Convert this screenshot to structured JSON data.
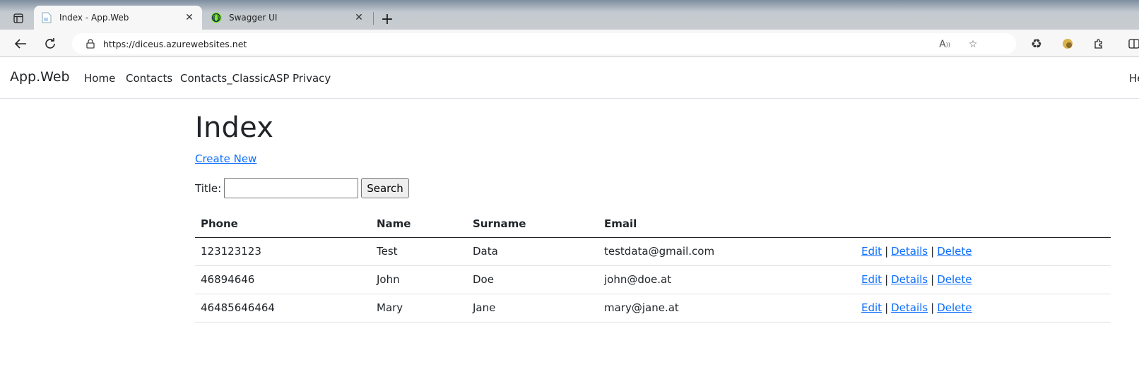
{
  "browser": {
    "tabs": [
      {
        "title": "Index - App.Web",
        "active": true,
        "icon": "page-icon"
      },
      {
        "title": "Swagger UI",
        "active": false,
        "icon": "swagger-icon"
      }
    ],
    "url": "https://diceus.azurewebsites.net",
    "toolbar_icons": [
      "back-icon",
      "refresh-icon",
      "lock-icon",
      "read-aloud-icon",
      "favorite-icon",
      "recycle-icon",
      "extension-icon",
      "puzzle-icon",
      "split-screen-icon"
    ]
  },
  "navbar": {
    "brand": "App.Web",
    "links": [
      "Home",
      "Contacts",
      "Contacts_ClassicASP",
      "Privacy"
    ],
    "right_text": "He"
  },
  "main": {
    "title": "Index",
    "create_link": "Create New",
    "search": {
      "label": "Title:",
      "value": "",
      "button": "Search"
    },
    "table": {
      "headers": [
        "Phone",
        "Name",
        "Surname",
        "Email"
      ],
      "rows": [
        {
          "phone": "123123123",
          "name": "Test",
          "surname": "Data",
          "email": "testdata@gmail.com"
        },
        {
          "phone": "46894646",
          "name": "John",
          "surname": "Doe",
          "email": "john@doe.at"
        },
        {
          "phone": "46485646464",
          "name": "Mary",
          "surname": "Jane",
          "email": "mary@jane.at"
        }
      ],
      "actions": {
        "edit": "Edit",
        "details": "Details",
        "delete": "Delete",
        "separator": "|"
      }
    }
  },
  "colors": {
    "link": "#0d6efd",
    "text": "#212529",
    "border": "#dee2e6"
  }
}
